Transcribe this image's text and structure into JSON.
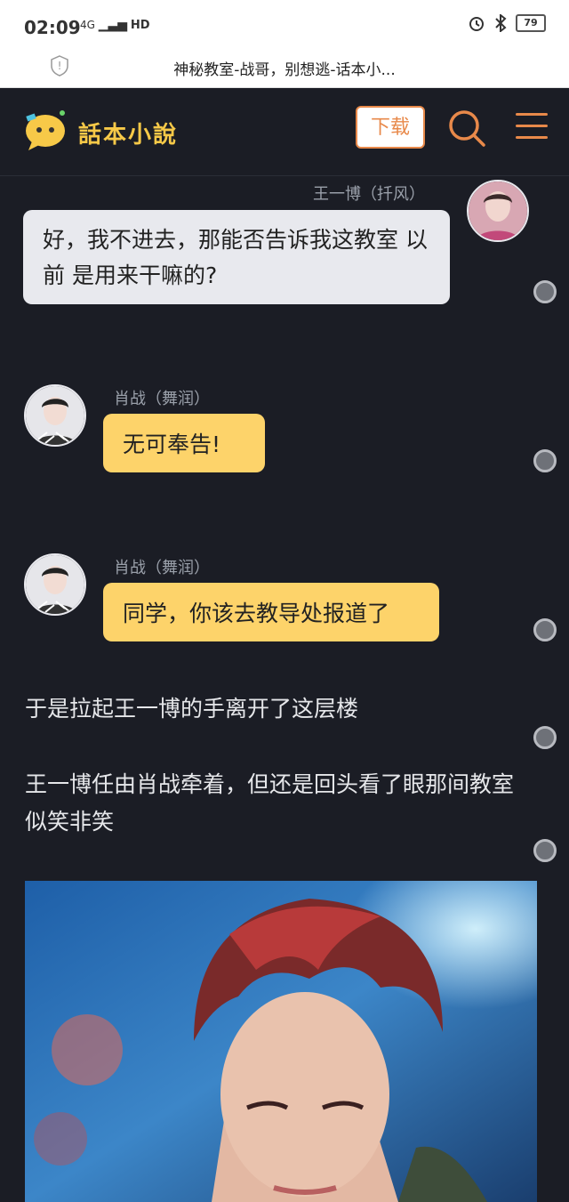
{
  "status": {
    "time": "02:09",
    "signal": "4G",
    "network_type": "HD",
    "battery": "79"
  },
  "browser": {
    "page_title": "神秘教室-战哥，别想逃-话本小..."
  },
  "header": {
    "logo_text": "話本小說",
    "download_label": "下载"
  },
  "messages": [
    {
      "speaker": "王一博（扦风）",
      "text": "好，我不进去，那能否告诉我这教室 以前 是用来干嘛的?"
    },
    {
      "speaker": "肖战（舞润）",
      "text": "无可奉告!"
    },
    {
      "speaker": "肖战（舞润）",
      "text": "同学，你该去教导处报道了"
    }
  ],
  "narration": [
    "于是拉起王一博的手离开了这层楼",
    "王一博任由肖战牵着，但还是回头看了眼那间教室似笑非笑"
  ],
  "colors": {
    "accent": "#e8894a",
    "logo": "#f7c948",
    "bubble_yellow": "#fdd36a",
    "background": "#1b1d25"
  }
}
